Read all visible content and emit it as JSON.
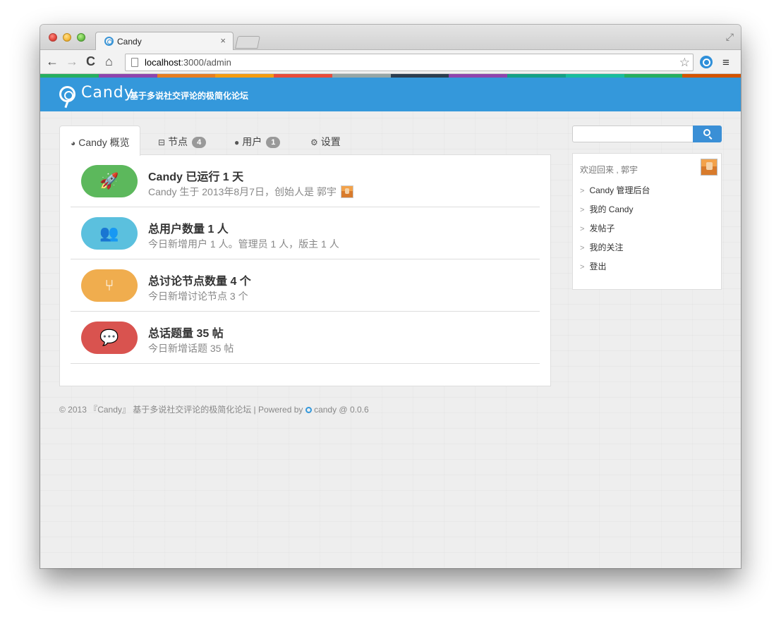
{
  "browser": {
    "tab_title": "Candy",
    "tab_close": "×",
    "url_host": "localhost",
    "url_path": ":3000/admin",
    "back": "←",
    "forward": "→",
    "reload": "C",
    "home": "⌂",
    "star": "☆",
    "menu": "≡",
    "fullscreen": "⤢"
  },
  "strip_colors": [
    "#27ae60",
    "#8e44ad",
    "#e67e22",
    "#f39c12",
    "#e74c3c",
    "#95a5a6",
    "#2c3e50",
    "#8e44ad",
    "#16a085",
    "#1abc9c",
    "#27ae60",
    "#d35400"
  ],
  "site": {
    "brand": "Candy",
    "slogan": "基于多说社交评论的极简化论坛",
    "header_color": "#3498db"
  },
  "tabs": [
    {
      "label": "Candy 概览",
      "icon": "dashboard-icon",
      "glyph": "◕"
    },
    {
      "label": "节点",
      "icon": "node-icon",
      "glyph": "⊟",
      "badge": "4"
    },
    {
      "label": "用户",
      "icon": "user-icon",
      "glyph": "●",
      "badge": "1"
    },
    {
      "label": "设置",
      "icon": "gears-icon",
      "glyph": "⚙"
    }
  ],
  "stats": [
    {
      "title": "Candy 已运行 1 天",
      "sub": "Candy 生于 2013年8月7日，创始人是 郭宇",
      "color": "#5cb85c",
      "icon": "rocket-icon",
      "glyph": "🚀"
    },
    {
      "title": "总用户数量 1 人",
      "sub": "今日新增用户 1 人。管理员 1 人，版主 1 人",
      "color": "#5bc0de",
      "icon": "users-icon",
      "glyph": "👥"
    },
    {
      "title": "总讨论节点数量 4 个",
      "sub": "今日新增讨论节点 3 个",
      "color": "#f0ad4e",
      "icon": "branch-icon",
      "glyph": "⑂"
    },
    {
      "title": "总话题量 35 帖",
      "sub": "今日新增话题 35 帖",
      "color": "#d9534f",
      "icon": "comments-icon",
      "glyph": "💬"
    }
  ],
  "sidebar": {
    "welcome": "欢迎回来 , 郭宇",
    "items": [
      "Candy 管理后台",
      "我的 Candy",
      "发帖子",
      "我的关注",
      "登出"
    ]
  },
  "footer": {
    "text": "© 2013 『Candy』 基于多说社交评论的极简化论坛 | Powered by",
    "powered": "candy @ 0.0.6"
  }
}
